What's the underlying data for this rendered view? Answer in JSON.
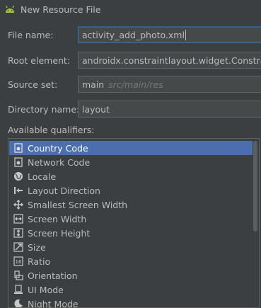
{
  "window": {
    "title": "New Resource File"
  },
  "form": {
    "file_name": {
      "label": "File name:",
      "value": "activity_add_photo.xml"
    },
    "root_element": {
      "label": "Root element:",
      "value": "androidx.constraintlayout.widget.ConstraintLayout"
    },
    "source_set": {
      "label": "Source set:",
      "value": "main",
      "hint": "src/main/res"
    },
    "directory_name": {
      "label": "Directory name:",
      "value": "layout"
    }
  },
  "qualifiers": {
    "label": "Available qualifiers:",
    "items": [
      {
        "label": "Country Code",
        "icon": "country-code-icon",
        "selected": true
      },
      {
        "label": "Network Code",
        "icon": "network-code-icon"
      },
      {
        "label": "Locale",
        "icon": "globe-icon"
      },
      {
        "label": "Layout Direction",
        "icon": "layout-direction-icon"
      },
      {
        "label": "Smallest Screen Width",
        "icon": "smallest-width-icon"
      },
      {
        "label": "Screen Width",
        "icon": "screen-width-icon"
      },
      {
        "label": "Screen Height",
        "icon": "screen-height-icon"
      },
      {
        "label": "Size",
        "icon": "size-icon"
      },
      {
        "label": "Ratio",
        "icon": "ratio-icon"
      },
      {
        "label": "Orientation",
        "icon": "orientation-icon"
      },
      {
        "label": "UI Mode",
        "icon": "ui-mode-icon"
      },
      {
        "label": "Night Mode",
        "icon": "night-mode-icon"
      }
    ]
  },
  "colors": {
    "selection": "#4b6eaf",
    "android_green": "#a4c639",
    "background": "#3c3f41"
  }
}
